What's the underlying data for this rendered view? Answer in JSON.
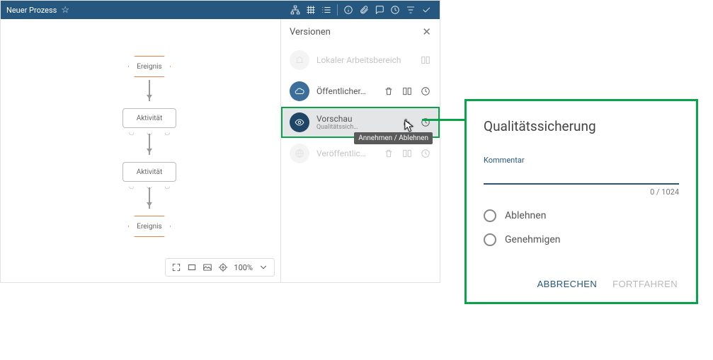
{
  "topbar": {
    "title": "Neuer Prozess"
  },
  "diagram": {
    "ereignis1": "Ereignis",
    "aktivitaet1": "Aktivität",
    "aktivitaet2": "Aktivität",
    "ereignis2": "Ereignis"
  },
  "zoom": {
    "value": "100%"
  },
  "versions": {
    "title": "Versionen",
    "tooltip": "Annehmen / Ablehnen",
    "rows": [
      {
        "title": "Lokaler Arbeitsbereich",
        "sub": ""
      },
      {
        "title": "Öffentlicher…",
        "sub": ""
      },
      {
        "title": "Vorschau",
        "sub": "Qualitätssich…"
      },
      {
        "title": "Veröffentlic…",
        "sub": ""
      }
    ]
  },
  "dialog": {
    "title": "Qualitätssicherung",
    "comment_label": "Kommentar",
    "comment_value": "",
    "char_count": "0 / 1024",
    "opt_reject": "Ablehnen",
    "opt_approve": "Genehmigen",
    "btn_cancel": "ABBRECHEN",
    "btn_continue": "FORTFAHREN"
  }
}
